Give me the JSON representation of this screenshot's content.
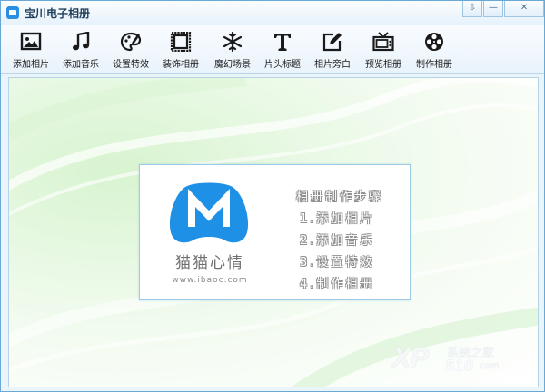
{
  "window": {
    "title": "宝川电子相册",
    "controls": [
      {
        "name": "menu-button",
        "glyph": "⇳"
      },
      {
        "name": "minimize-button",
        "glyph": "—"
      },
      {
        "name": "close-button",
        "glyph": "✕"
      }
    ]
  },
  "toolbar": {
    "items": [
      {
        "name": "add-photo-button",
        "icon": "image-icon",
        "label": "添加相片"
      },
      {
        "name": "add-music-button",
        "icon": "music-note-icon",
        "label": "添加音乐"
      },
      {
        "name": "effects-button",
        "icon": "palette-icon",
        "label": "设置特效"
      },
      {
        "name": "decorate-button",
        "icon": "frame-icon",
        "label": "装饰相册"
      },
      {
        "name": "magic-scene-button",
        "icon": "snowflake-icon",
        "label": "魔幻场景"
      },
      {
        "name": "title-button",
        "icon": "text-t-icon",
        "label": "片头标题"
      },
      {
        "name": "caption-button",
        "icon": "edit-pen-icon",
        "label": "相片旁白"
      },
      {
        "name": "preview-button",
        "icon": "tv-icon",
        "label": "预览相册"
      },
      {
        "name": "make-album-button",
        "icon": "film-reel-icon",
        "label": "制作相册"
      }
    ]
  },
  "welcome": {
    "brand": "猫猫心情",
    "url": "www.ibaoc.com",
    "steps_title": "相册制作步骤",
    "steps": [
      "1.添加相片",
      "2.添加音乐",
      "3.设置特效",
      "4.制作相册"
    ],
    "logo_color": "#1e90e6"
  },
  "watermark": {
    "xp": "XP",
    "cn": "系统之家",
    "num": "510",
    "domain": "com"
  }
}
